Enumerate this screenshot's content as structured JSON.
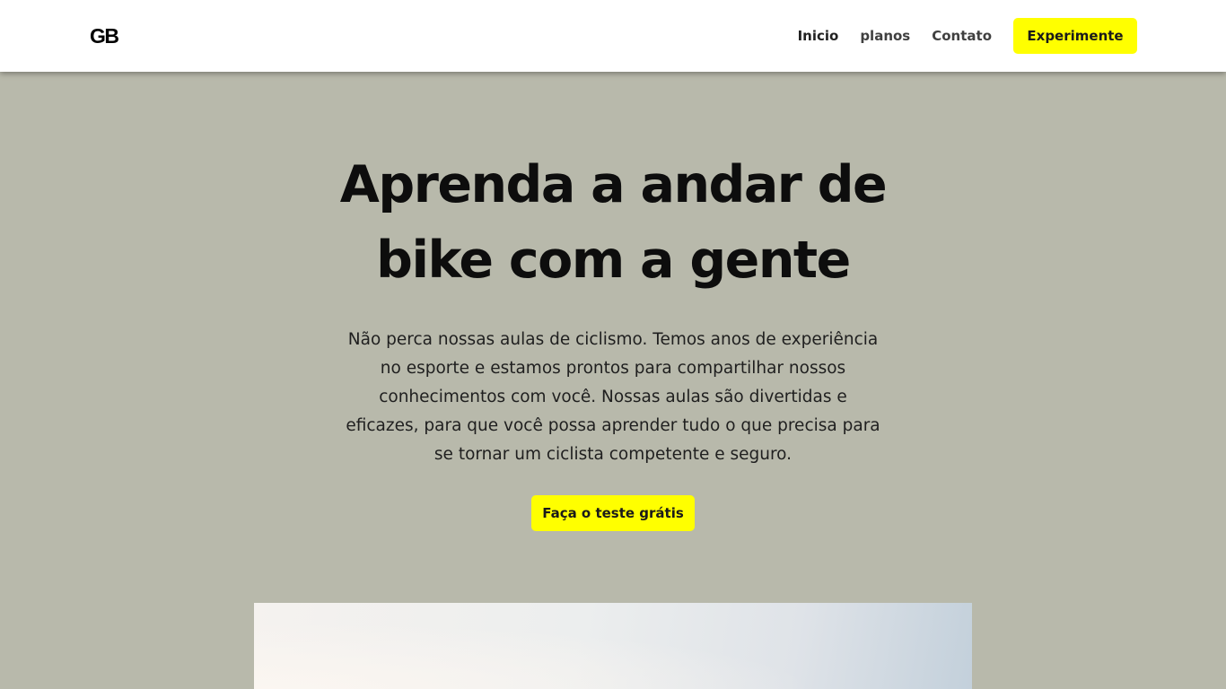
{
  "header": {
    "logo": "GB",
    "nav": [
      {
        "label": "Inicio"
      },
      {
        "label": "planos"
      },
      {
        "label": "Contato"
      }
    ],
    "cta_label": "Experimente"
  },
  "hero": {
    "title": "Aprenda a andar de bike com a gente",
    "text": "Não perca nossas aulas de ciclismo. Temos anos de experiência no esporte e estamos prontos para compartilhar nossos conhecimentos com você. Nossas aulas são divertidas e eficazes, para que você possa aprender tudo o que precisa para se tornar um ciclista competente e seguro.",
    "cta_label": "Faça o teste grátis"
  },
  "colors": {
    "accent": "#ffff00",
    "background": "#b8b9ab",
    "header_bg": "#ffffff"
  }
}
